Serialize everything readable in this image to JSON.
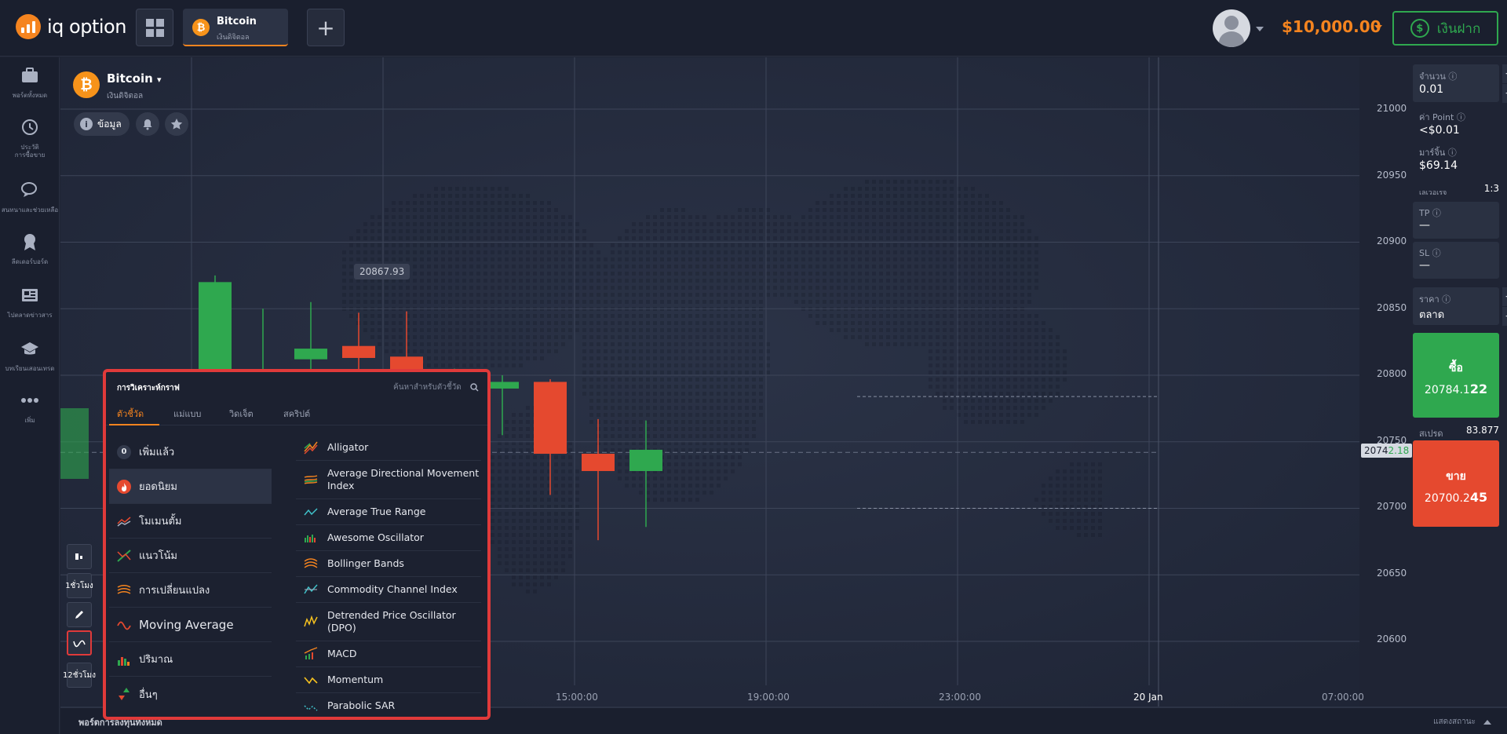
{
  "header": {
    "logo_text": "iq option",
    "asset_tab": {
      "name": "Bitcoin",
      "sub": "เงินดิจิตอล",
      "icon": "bitcoin-icon"
    },
    "balance": "$10,000.00",
    "deposit_label": "เงินฝาก"
  },
  "sidebar": {
    "items": [
      {
        "label": "พอร์ตทั้งหมด",
        "icon": "briefcase-icon"
      },
      {
        "label": "ประวัติ\nการซื้อขาย",
        "icon": "history-icon"
      },
      {
        "label": "สนทนาและช่วยเหลือ",
        "icon": "chat-icon"
      },
      {
        "label": "ลีดเดอร์บอร์ด",
        "icon": "award-icon"
      },
      {
        "label": "ไปตลาดข่าวสาร",
        "icon": "news-icon"
      },
      {
        "label": "บทเรียนเสอนเทรด",
        "icon": "graduation-icon"
      },
      {
        "label": "เพิ่ม",
        "icon": "more-icon"
      }
    ]
  },
  "chart": {
    "asset_name": "Bitcoin",
    "asset_sub": "เงินดิจิตอล",
    "info_label": "ข้อมูล",
    "highlight_price": "20867.93",
    "current_price_main": "2074",
    "current_price_tail": "2.18",
    "time_labels": [
      "15:00:00",
      "19:00:00",
      "23:00:00",
      "20 Jan",
      "07:00:00"
    ],
    "price_labels": [
      "21000",
      "20950",
      "20900",
      "20850",
      "20800",
      "20750",
      "20700",
      "20650",
      "20600"
    ],
    "tools": {
      "period_1": "1ชั่วโมง",
      "period_2": "12ชั่วโมง"
    }
  },
  "chart_data": {
    "type": "candlestick",
    "y_range": [
      20580,
      21020
    ],
    "candles": [
      {
        "o": 20780,
        "h": 20790,
        "l": 20740,
        "c": 20786,
        "dir": "up"
      },
      {
        "o": 20785,
        "h": 20795,
        "l": 20700,
        "c": 20781,
        "dir": "down"
      },
      {
        "o": 20785,
        "h": 20875,
        "l": 20760,
        "c": 20870,
        "dir": "up"
      },
      {
        "o": 20785,
        "h": 20850,
        "l": 20740,
        "c": 20790,
        "dir": "up"
      },
      {
        "o": 20812,
        "h": 20855,
        "l": 20790,
        "c": 20820,
        "dir": "up"
      },
      {
        "o": 20822,
        "h": 20847,
        "l": 20797,
        "c": 20813,
        "dir": "down"
      },
      {
        "o": 20814,
        "h": 20848,
        "l": 20757,
        "c": 20767,
        "dir": "down"
      },
      {
        "o": 20767,
        "h": 20805,
        "l": 20732,
        "c": 20790,
        "dir": "up"
      },
      {
        "o": 20790,
        "h": 20800,
        "l": 20755,
        "c": 20795,
        "dir": "up"
      },
      {
        "o": 20795,
        "h": 20797,
        "l": 20710,
        "c": 20741,
        "dir": "down"
      },
      {
        "o": 20741,
        "h": 20767,
        "l": 20676,
        "c": 20728,
        "dir": "down"
      },
      {
        "o": 20728,
        "h": 20766,
        "l": 20686,
        "c": 20744,
        "dir": "up"
      }
    ]
  },
  "right_panel": {
    "amount_label": "จำนวน",
    "amount_value": "0.01",
    "point_label": "ค่า Point",
    "point_value": "<$0.01",
    "margin_label": "มาร์จิ้น",
    "margin_value": "$69.14",
    "leverage_label": "เลเวอเรจ",
    "leverage_value": "1:3",
    "tp_label": "TP",
    "tp_value": "—",
    "sl_label": "SL",
    "sl_value": "—",
    "price_label": "ราคา",
    "price_value": "ตลาด",
    "buy_label": "ซื้อ",
    "buy_price_main": "20784.1",
    "buy_price_tail": "22",
    "spread_label": "สเปรด",
    "spread_value": "83.877",
    "sell_label": "ขาย",
    "sell_price_main": "20700.2",
    "sell_price_tail": "45"
  },
  "popup": {
    "title": "การวิเคราะห์กราฟ",
    "search_placeholder": "ค้นหาสำหรับตัวชี้วัด",
    "tabs": [
      "ตัวชี้วัด",
      "แม่แบบ",
      "วิดเจ็ต",
      "สคริปต์"
    ],
    "categories": [
      {
        "label": "เพิ่มแล้ว",
        "badge": "0"
      },
      {
        "label": "ยอดนิยม",
        "icon": "fire-icon"
      },
      {
        "label": "โมเมนตั้ม",
        "icon": "momentum-icon"
      },
      {
        "label": "แนวโน้ม",
        "icon": "trend-icon"
      },
      {
        "label": "การเปลี่ยนแปลง",
        "icon": "volatility-icon"
      },
      {
        "label": "Moving Average",
        "icon": "wave-icon"
      },
      {
        "label": "ปริมาณ",
        "icon": "volume-icon"
      },
      {
        "label": "อื่นๆ",
        "icon": "updown-icon"
      }
    ],
    "indicators": [
      "Alligator",
      "Average Directional Movement Index",
      "Average True Range",
      "Awesome Oscillator",
      "Bollinger Bands",
      "Commodity Channel Index",
      "Detrended Price Oscillator (DPO)",
      "MACD",
      "Momentum",
      "Parabolic SAR"
    ]
  },
  "bottombar": {
    "left": "พอร์ตการลงทุนทั้งหมด",
    "right": "แสดงสถานะ"
  },
  "colors": {
    "accent": "#f5841f",
    "up": "#2fa84f",
    "down": "#e5492f",
    "bg": "#232a3c"
  }
}
